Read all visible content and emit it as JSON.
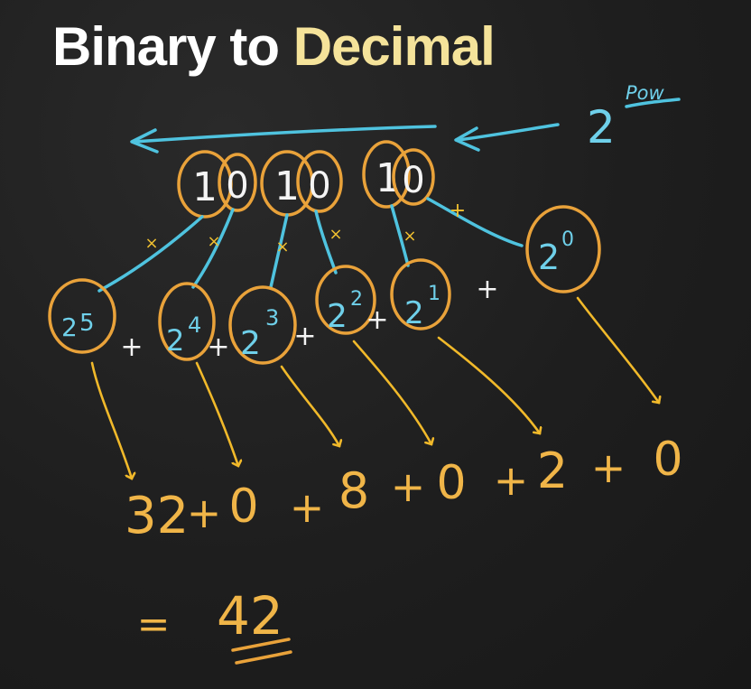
{
  "title": {
    "part1": "Binary to ",
    "part2": "Decimal"
  },
  "pow_label": {
    "base": "2",
    "exp": "Pow"
  },
  "binary_digits": [
    "1",
    "0",
    "1",
    "0",
    "1",
    "0"
  ],
  "powers": [
    {
      "base": "2",
      "exp": "5"
    },
    {
      "base": "2",
      "exp": "4"
    },
    {
      "base": "2",
      "exp": "3"
    },
    {
      "base": "2",
      "exp": "2"
    },
    {
      "base": "2",
      "exp": "1"
    },
    {
      "base": "2",
      "exp": "0"
    }
  ],
  "operators": {
    "plus": "+",
    "times": "×"
  },
  "terms": [
    "32",
    "0",
    "8",
    "0",
    "2",
    "0"
  ],
  "result": {
    "equals": "=",
    "value": "42"
  },
  "colors": {
    "title_white": "#ffffff",
    "title_accent": "#f5e39a",
    "chalk_blue": "#4fc3df",
    "chalk_orange": "#e9a23a",
    "chalk_yellow": "#f1b92a",
    "board": "#1f1f1f"
  }
}
